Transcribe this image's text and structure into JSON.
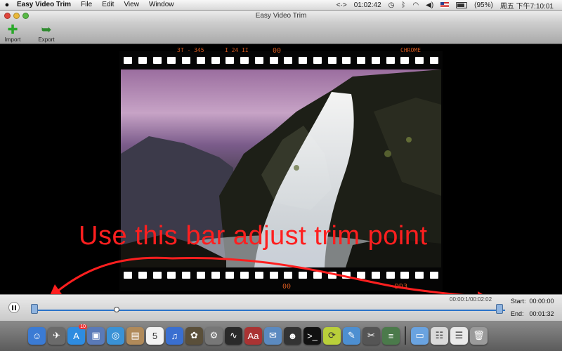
{
  "menubar": {
    "app_name": "Easy Video Trim",
    "menus": [
      "File",
      "Edit",
      "View",
      "Window"
    ],
    "clock": "01:02:42",
    "battery": "(95%)",
    "datetime": "周五 下午7:10:01"
  },
  "window": {
    "title": "Easy Video Trim"
  },
  "toolbar": {
    "import_label": "Import",
    "export_label": "Export"
  },
  "film": {
    "top_labels": [
      "3T - 345",
      "I 24 II",
      "00",
      "CHROME"
    ],
    "bottom_labels": [
      "00",
      "DD3"
    ]
  },
  "annotation": {
    "text": "Use this bar adjust trim point",
    "color": "#ff1f1f"
  },
  "player": {
    "timecode_left": "00:00:1",
    "timecode_right": "00:02:02",
    "start_label": "Start:",
    "start_value": "00:00:00",
    "end_label": "End:",
    "end_value": "00:01:32",
    "playhead_fraction": 0.18,
    "accent": "#2a73c9"
  },
  "dock": {
    "items": [
      {
        "name": "finder-icon",
        "color": "#3b7bd4",
        "glyph": "☺"
      },
      {
        "name": "launchpad-icon",
        "color": "#6b6b6b",
        "glyph": "✈"
      },
      {
        "name": "app-store-icon",
        "color": "#2e8ce0",
        "glyph": "A",
        "badge": "10"
      },
      {
        "name": "photo-icon",
        "color": "#5a7ab8",
        "glyph": "▣"
      },
      {
        "name": "safari-icon",
        "color": "#3a92d6",
        "glyph": "◎"
      },
      {
        "name": "contacts-icon",
        "color": "#b08a5a",
        "glyph": "▤"
      },
      {
        "name": "calendar-icon",
        "color": "#f2f2f2",
        "glyph": "5"
      },
      {
        "name": "itunes-icon",
        "color": "#3a6fd0",
        "glyph": "♫"
      },
      {
        "name": "iphoto-icon",
        "color": "#5a4f3a",
        "glyph": "✿"
      },
      {
        "name": "system-prefs-icon",
        "color": "#777",
        "glyph": "⚙"
      },
      {
        "name": "activity-icon",
        "color": "#2a2a2a",
        "glyph": "∿"
      },
      {
        "name": "dictionary-icon",
        "color": "#a33",
        "glyph": "Aa"
      },
      {
        "name": "preview-icon",
        "color": "#5b8ac0",
        "glyph": "✉"
      },
      {
        "name": "qq-icon",
        "color": "#333",
        "glyph": "☻"
      },
      {
        "name": "terminal-icon",
        "color": "#111",
        "glyph": ">_"
      },
      {
        "name": "sync-icon",
        "color": "#b9cf3a",
        "glyph": "⟳"
      },
      {
        "name": "xcode-icon",
        "color": "#4d8fd1",
        "glyph": "✎"
      },
      {
        "name": "tools-icon",
        "color": "#555",
        "glyph": "✂"
      },
      {
        "name": "notes-icon",
        "color": "#4b7a4b",
        "glyph": "≡"
      },
      {
        "name": "folder-icon",
        "color": "#6aa3e0",
        "glyph": "▭"
      },
      {
        "name": "downloads-icon",
        "color": "#d9d9d9",
        "glyph": "☷"
      },
      {
        "name": "document-icon",
        "color": "#e9e9e9",
        "glyph": "☰"
      },
      {
        "name": "trash-icon",
        "color": "#9a9a9a",
        "glyph": "🗑"
      }
    ]
  }
}
